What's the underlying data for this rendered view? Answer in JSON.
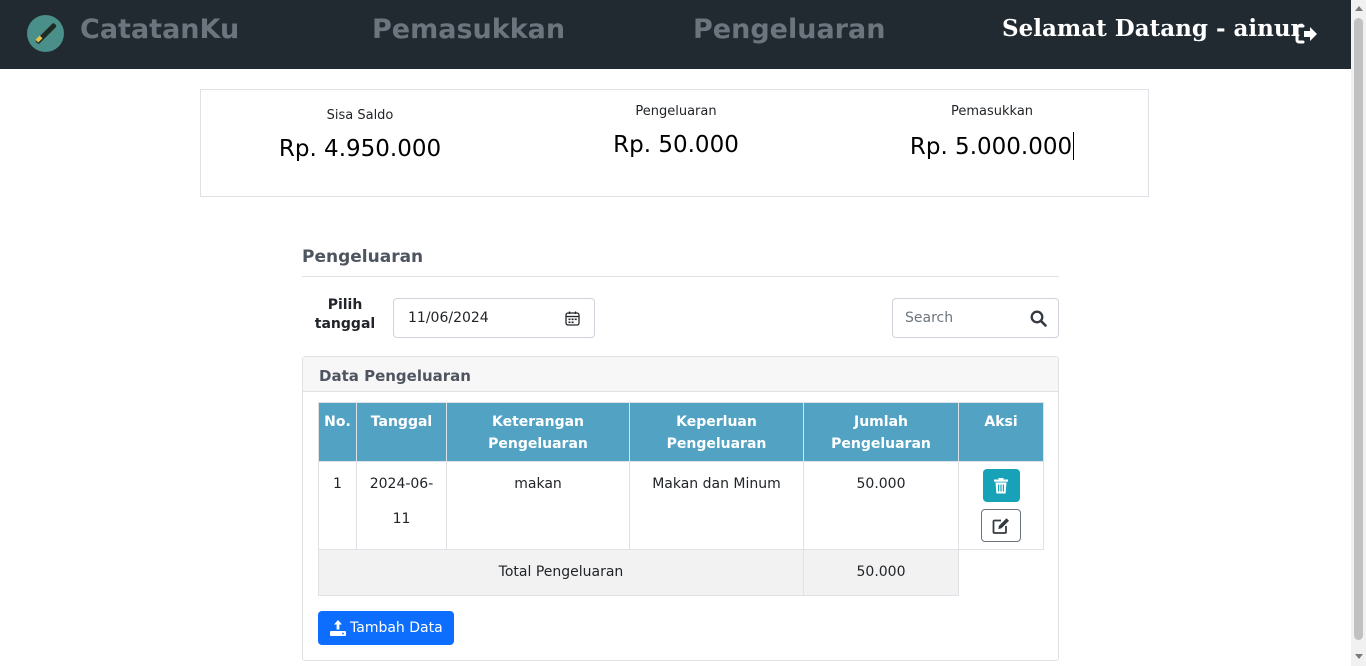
{
  "navbar": {
    "brand": "CatatanKu",
    "links": [
      "Pemasukkan",
      "Pengeluaran"
    ],
    "welcome": "Selamat Datang - ainur"
  },
  "summary": {
    "saldo_label": "Sisa Saldo",
    "saldo_value": "Rp. 4.950.000",
    "pengeluaran_label": "Pengeluaran",
    "pengeluaran_value": "Rp. 50.000",
    "pemasukkan_label": "Pemasukkan",
    "pemasukkan_value": "Rp. 5.000.000"
  },
  "section": {
    "title": "Pengeluaran",
    "date_label": "Pilih tanggal",
    "date_value": "11/06/2024",
    "search_placeholder": "Search"
  },
  "card": {
    "title": "Data Pengeluaran"
  },
  "table": {
    "headers": [
      "No.",
      "Tanggal",
      "Keterangan Pengeluaran",
      "Keperluan Pengeluaran",
      "Jumlah Pengeluaran",
      "Aksi"
    ],
    "rows": [
      {
        "no": "1",
        "tanggal": "2024-06-11",
        "keterangan": "makan",
        "keperluan": "Makan dan Minum",
        "jumlah": "50.000"
      }
    ],
    "total_label": "Total Pengeluaran",
    "total_value": "50.000"
  },
  "buttons": {
    "add_label": "Tambah Data"
  },
  "colors": {
    "navbar_bg": "#212a30",
    "table_header": "#52a3c3",
    "delete_button": "#17a2b8",
    "primary_button": "#0d6efd"
  },
  "icons": [
    "pen-logo-icon",
    "logout-icon",
    "calendar-icon",
    "search-icon",
    "trash-icon",
    "edit-icon",
    "upload-icon"
  ]
}
